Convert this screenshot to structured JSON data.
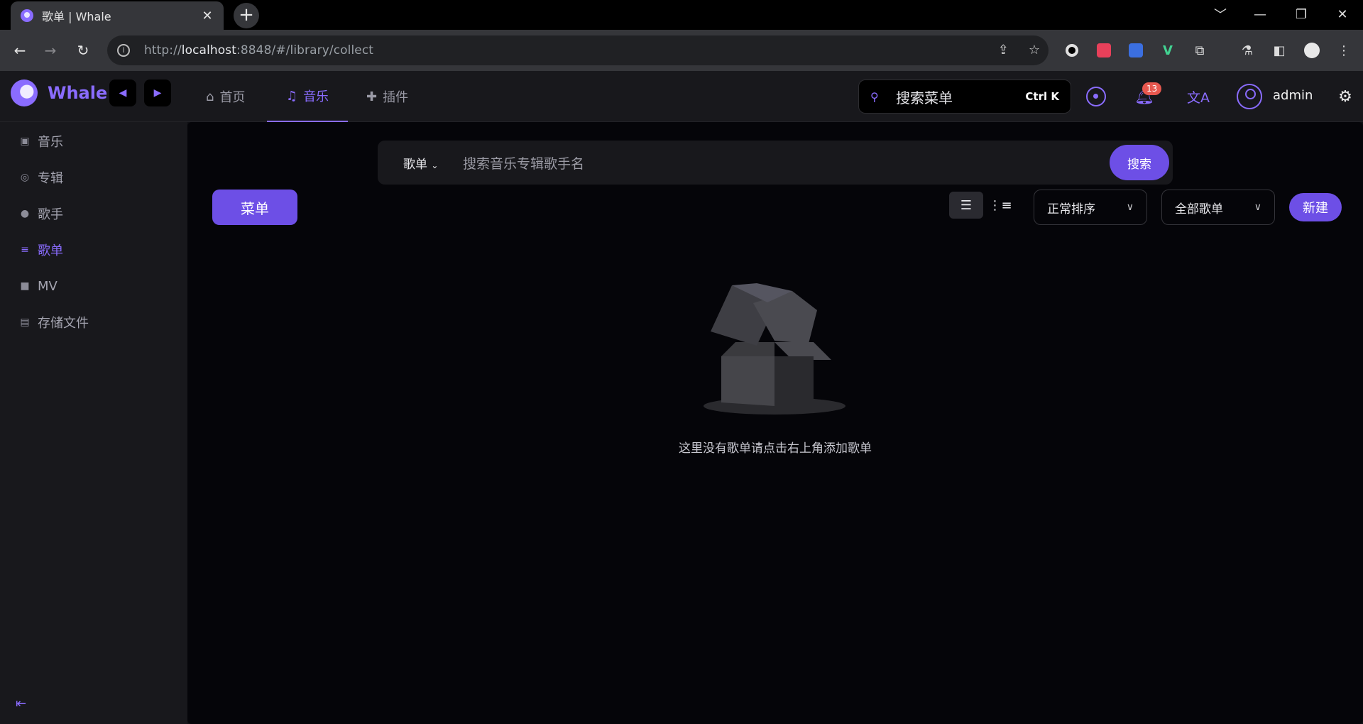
{
  "browser": {
    "tab_title": "歌单 | Whale",
    "tab_close": "✕",
    "new_tab": "+",
    "url_prefix": "http://",
    "url_host": "localhost",
    "url_rest": ":8848/#/library/collect",
    "window_controls": [
      "﹀",
      "—",
      "❐",
      "✕"
    ]
  },
  "app": {
    "brand": "Whale",
    "nav": [
      {
        "label": "首页",
        "icon": "home-icon"
      },
      {
        "label": "音乐",
        "icon": "music-icon",
        "active": true
      },
      {
        "label": "插件",
        "icon": "puzzle-icon"
      }
    ],
    "search_menu": {
      "label": "搜索菜单",
      "shortcut": "Ctrl K"
    },
    "notification_count": "13",
    "username": "admin"
  },
  "sidebar": {
    "items": [
      {
        "label": "音乐",
        "icon": "music-icon"
      },
      {
        "label": "专辑",
        "icon": "album-icon"
      },
      {
        "label": "歌手",
        "icon": "user-icon"
      },
      {
        "label": "歌单",
        "icon": "playlist-icon",
        "active": true
      },
      {
        "label": "MV",
        "icon": "video-icon"
      },
      {
        "label": "存储文件",
        "icon": "folder-icon"
      }
    ]
  },
  "main": {
    "search": {
      "scope": "歌单",
      "placeholder": "搜索音乐专辑歌手名",
      "button": "搜索"
    },
    "menu_button": "菜单",
    "sort_select": "正常排序",
    "filter_select": "全部歌单",
    "new_button": "新建",
    "empty_text": "这里没有歌单请点击右上角添加歌单"
  },
  "colors": {
    "accent": "#8a6cff",
    "button": "#6d4fe6",
    "badge": "#e8584f"
  }
}
